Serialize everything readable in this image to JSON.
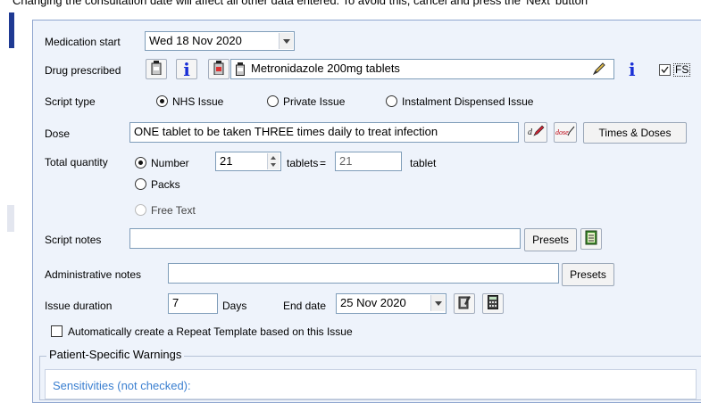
{
  "banner": "Changing the consultation date will affect all other data entered. To avoid this, cancel and press the 'Next' button",
  "medication_start": {
    "label": "Medication start",
    "value": "Wed 18 Nov 2020"
  },
  "drug": {
    "label": "Drug prescribed",
    "name": "Metronidazole 200mg tablets",
    "fs_label": "FS"
  },
  "script_type": {
    "label": "Script type",
    "options": [
      "NHS Issue",
      "Private Issue",
      "Instalment Dispensed Issue"
    ],
    "selected": "NHS Issue"
  },
  "dose": {
    "label": "Dose",
    "value": "ONE tablet to be taken THREE times daily to treat infection",
    "times_button": "Times & Doses",
    "icon1_text": "d",
    "icon2_text": "dose"
  },
  "quantity": {
    "label": "Total quantity",
    "options": [
      "Number",
      "Packs",
      "Free Text"
    ],
    "selected": "Number",
    "number_value": "21",
    "unit": "tablets",
    "equals": "=",
    "total_value": "21",
    "total_unit": "tablet"
  },
  "script_notes": {
    "label": "Script notes",
    "value": "",
    "presets_button": "Presets"
  },
  "admin_notes": {
    "label": "Administrative notes",
    "value": "",
    "presets_button": "Presets"
  },
  "issue_duration": {
    "label": "Issue duration",
    "value": "7",
    "unit": "Days",
    "end_date_label": "End date",
    "end_date_value": "25 Nov 2020"
  },
  "repeat_template": {
    "label": "Automatically create a Repeat Template based on this Issue",
    "checked": false
  },
  "warnings": {
    "title": "Patient-Specific Warnings",
    "sensitivities": "Sensitivities (not checked):"
  },
  "colors": {
    "panel_bg": "#eef3fb",
    "info_blue": "#1a2fd6",
    "link_blue": "#3a7fd0"
  }
}
